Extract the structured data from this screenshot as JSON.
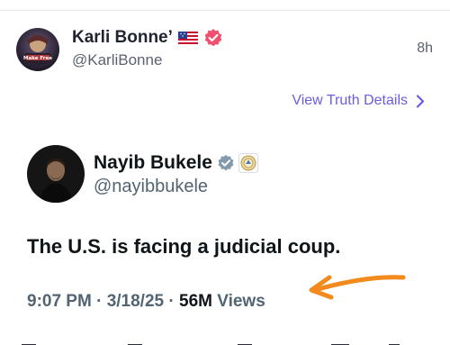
{
  "post": {
    "author_name": "Karli Bonne’",
    "author_handle": "@KarliBonne",
    "time_ago": "8h",
    "view_details_label": "View Truth Details",
    "avatar_text": "Make Free"
  },
  "embedded": {
    "author_name": "Nayib Bukele",
    "author_handle": "@nayibbukele",
    "text": "The U.S. is facing a judicial coup.",
    "time": "9:07 PM",
    "date": "3/18/25",
    "views_count": "56M",
    "views_label": "Views",
    "separator": "·"
  },
  "colors": {
    "accent_purple": "#6b5ce0",
    "verified_pink": "#f0506e",
    "arrow_orange": "#f28a1e",
    "x_verified_gray": "#829aab"
  },
  "icons": {
    "flag": "us-flag-icon",
    "verified": "verified-badge-icon",
    "chevron": "chevron-right-icon",
    "gray_verified": "gray-verified-badge-icon",
    "seal": "government-seal-icon",
    "arrow": "orange-arrow-icon"
  }
}
